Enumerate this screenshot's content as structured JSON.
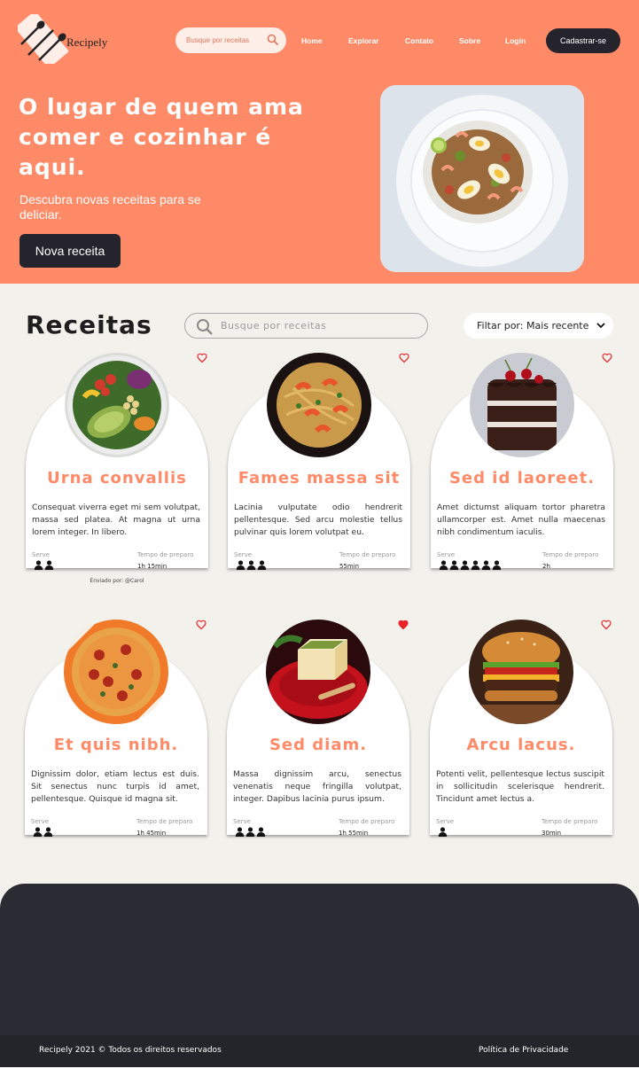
{
  "brand": {
    "name": "Recipely"
  },
  "nav": {
    "search_placeholder": "Busque por receitas",
    "links": [
      "Home",
      "Explorar",
      "Contato",
      "Sobre",
      "Login"
    ],
    "signup_label": "Cadastrar-se"
  },
  "hero": {
    "title": "O lugar de quem ama comer e cozinhar é aqui.",
    "subtitle": "Descubra novas receitas para se deliciar.",
    "button_label": "Nova receita"
  },
  "recipes": {
    "heading": "Receitas",
    "search_placeholder": "Busque por receitas",
    "filter_label": "Filtar por: Mais recente",
    "serve_label": "Serve",
    "time_label": "Tempo de preparo",
    "items": [
      {
        "title": "Urna convallis",
        "description": "Consequat viverra eget mi sem volutpat, massa sed platea. At magna ut urna lorem integer. In libero.",
        "serves": 2,
        "time": "1h 15min",
        "sent_by": "Enviado por: @Carol",
        "favorited": false,
        "image": "salad-bowl"
      },
      {
        "title": "Fames massa sit",
        "description": "Lacinia vulputate odio hendrerit pellentesque. Sed arcu molestie tellus pulvinar quis lorem volutpat eu.",
        "serves": 3,
        "time": "55min",
        "favorited": false,
        "image": "shrimp-pasta"
      },
      {
        "title": "Sed id laoreet.",
        "description": "Amet dictumst aliquam tortor pharetra ullamcorper est. Amet nulla maecenas nibh condimentum iaculis.",
        "serves": 6,
        "time": "2h",
        "favorited": false,
        "image": "chocolate-cake"
      },
      {
        "title": "Et quis nibh.",
        "description": "Dignissim dolor, etiam lectus est duis. Sit senectus nunc turpis id amet, pellentesque. Quisque id magna sit.",
        "serves": 2,
        "time": "1h 45min",
        "favorited": false,
        "image": "pizza"
      },
      {
        "title": "Sed diam.",
        "description": "Massa dignissim arcu, senectus venenatis neque fringilla volutpat, integer. Dapibus lacinia purus ipsum.",
        "serves": 3,
        "time": "1h 55min",
        "favorited": true,
        "image": "matcha-dessert"
      },
      {
        "title": "Arcu lacus.",
        "description": "Potenti velit, pellentesque lectus suscipit in sollicitudin scelerisque hendrerit. Tincidunt amet lectus a.",
        "serves": 1,
        "time": "30min",
        "favorited": false,
        "image": "burger"
      }
    ]
  },
  "footer": {
    "copyright": "Recipely 2021 © Todos os direitos reservados",
    "privacy_label": "Política de Privacidade"
  },
  "colors": {
    "accent": "#fe8a67",
    "dark": "#25242c",
    "background": "#f2f1ec",
    "heart": "#e8232a"
  }
}
